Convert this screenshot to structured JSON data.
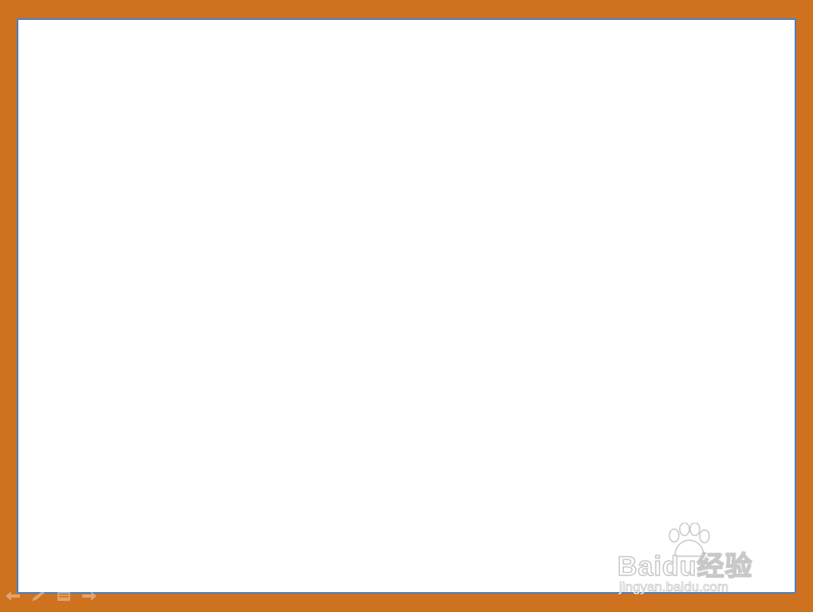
{
  "frame": {
    "border_color": "#cf7220",
    "slide_background": "#ffffff",
    "slide_outline_color": "#4a7fc1"
  },
  "watermark": {
    "brand_latin": "Bai",
    "brand_paw_text": "du",
    "brand_cn": "经验",
    "url": "jingyan.baidu.com",
    "paw_icon": "paw-icon"
  },
  "controls": {
    "items": [
      {
        "name": "previous-slide",
        "icon": "arrow-left-icon"
      },
      {
        "name": "pen-tool",
        "icon": "pen-icon"
      },
      {
        "name": "slide-menu",
        "icon": "menu-icon"
      },
      {
        "name": "next-slide",
        "icon": "arrow-right-icon"
      }
    ]
  }
}
